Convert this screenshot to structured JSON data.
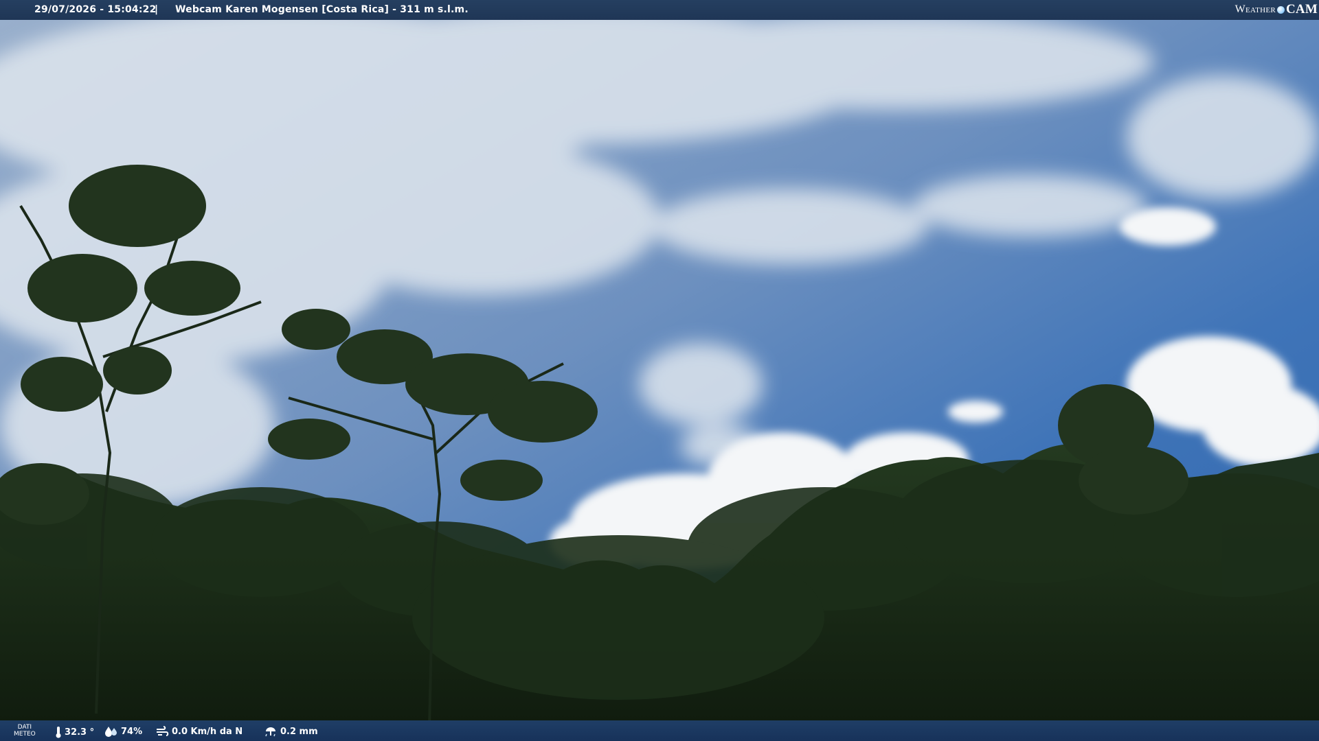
{
  "header": {
    "datetime": "29/07/2026 - 15:04:22",
    "separator": "|",
    "title": "Webcam Karen Mogensen [Costa Rica] - 311 m s.l.m."
  },
  "logo": {
    "word1": "Weather",
    "word2": "CAM"
  },
  "footer": {
    "label_line1": "DATI",
    "label_line2": "METEO",
    "temperature": "32.3 °",
    "humidity": "74%",
    "wind": "0.0 Km/h da N",
    "rain": "0.2 mm"
  },
  "colors": {
    "sky_top": "#8fa9c8",
    "sky_blue": "#3f74b8",
    "forest": "#1a2a17",
    "bar": "#1f3656"
  },
  "icons": {
    "temperature": "thermometer-icon",
    "humidity": "humidity-drops-icon",
    "wind": "wind-icon",
    "rain": "rain-gauge-icon"
  }
}
